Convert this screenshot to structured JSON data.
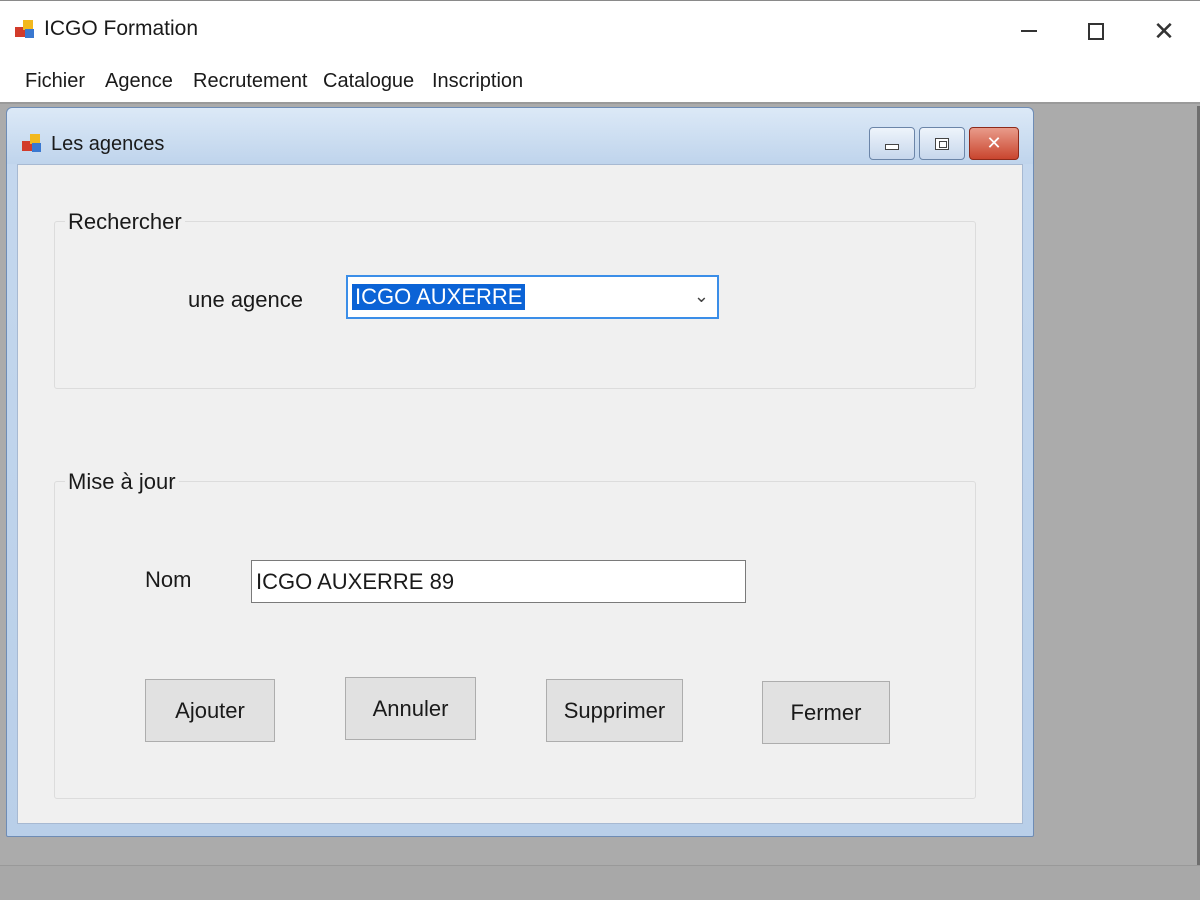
{
  "window": {
    "title": "ICGO Formation",
    "icon": "app-icon"
  },
  "menu": {
    "items": [
      {
        "label": "Fichier"
      },
      {
        "label": "Agence"
      },
      {
        "label": "Recrutement"
      },
      {
        "label": "Catalogue"
      },
      {
        "label": "Inscription"
      }
    ]
  },
  "child_form": {
    "title": "Les agences",
    "search_group": {
      "legend": "Rechercher",
      "label": "une agence",
      "selected_value": "ICGO AUXERRE"
    },
    "update_group": {
      "legend": "Mise à jour",
      "nom_label": "Nom",
      "nom_value": "ICGO AUXERRE 89"
    },
    "buttons": {
      "ajouter": "Ajouter",
      "annuler": "Annuler",
      "supprimer": "Supprimer",
      "fermer": "Fermer"
    }
  },
  "colors": {
    "selection": "#0b63d6",
    "close_button": "#c9452e",
    "workspace": "#ababab"
  }
}
